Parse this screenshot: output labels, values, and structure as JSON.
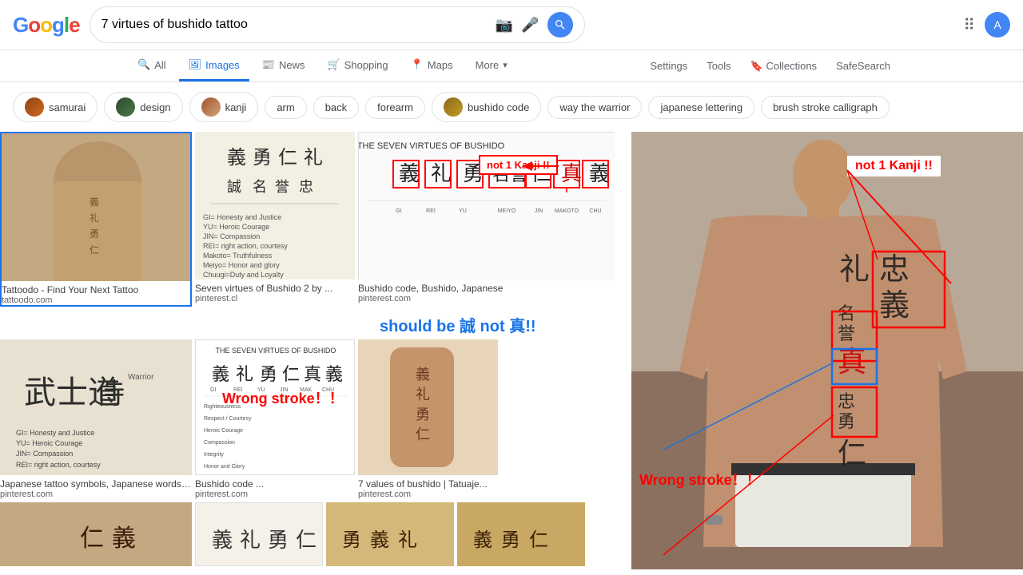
{
  "header": {
    "logo": [
      "G",
      "o",
      "o",
      "g",
      "l",
      "e"
    ],
    "search_query": "7 virtues of bushido tattoo",
    "search_placeholder": "Search"
  },
  "nav": {
    "tabs": [
      {
        "label": "All",
        "icon": "🔍",
        "active": false
      },
      {
        "label": "Images",
        "icon": "🖼",
        "active": true
      },
      {
        "label": "News",
        "icon": "📰",
        "active": false
      },
      {
        "label": "Shopping",
        "icon": "🛒",
        "active": false
      },
      {
        "label": "Maps",
        "icon": "📍",
        "active": false
      },
      {
        "label": "More",
        "icon": "",
        "active": false
      }
    ],
    "settings": "Settings",
    "tools": "Tools",
    "collections": "Collections",
    "safesearch": "SafeSearch"
  },
  "filters": [
    {
      "label": "samurai",
      "has_thumb": true
    },
    {
      "label": "design",
      "has_thumb": true
    },
    {
      "label": "kanji",
      "has_thumb": true
    },
    {
      "label": "arm",
      "has_thumb": false
    },
    {
      "label": "back",
      "has_thumb": false
    },
    {
      "label": "forearm",
      "has_thumb": false
    },
    {
      "label": "bushido code",
      "has_thumb": true
    },
    {
      "label": "way the warrior",
      "has_thumb": false
    },
    {
      "label": "japanese lettering",
      "has_thumb": false
    },
    {
      "label": "brush stroke calligraph",
      "has_thumb": false
    }
  ],
  "results": {
    "row1": [
      {
        "title": "Tattoodo - Find Your Next Tattoo",
        "source": "tattoodo.com",
        "featured": true
      },
      {
        "title": "Seven virtues of Bushido 2 by ...",
        "source": "pinterest.cl",
        "featured": false
      },
      {
        "title": "Bushido code, Bushido, Japanese",
        "source": "pinterest.com",
        "featured": false
      }
    ],
    "row2": [
      {
        "title": "Japanese tattoo symbols, Japanese words ...",
        "source": "pinterest.com",
        "featured": false
      },
      {
        "title": "Bushido code ...",
        "source": "pinterest.com",
        "featured": false
      },
      {
        "title": "7 values of bushido | Tatuaje...",
        "source": "pinterest.com",
        "featured": false
      }
    ],
    "row3": [
      {
        "title": "",
        "source": "",
        "featured": false
      },
      {
        "title": "",
        "source": "",
        "featured": false
      },
      {
        "title": "",
        "source": "",
        "featured": false
      },
      {
        "title": "",
        "source": "",
        "featured": false
      }
    ]
  },
  "annotations": {
    "not1kanji": "not 1 Kanji !!",
    "shouldbe": "should be 誠 not 真!!",
    "wrongstroke": "Wrong stroke！！",
    "arrow1": "→",
    "kanji_chars": [
      "義",
      "礼",
      "勇",
      "名誉",
      "仁",
      "真",
      "忠"
    ]
  },
  "feature_kanji": {
    "boxes": [
      "忠義",
      "礼",
      "名誉",
      "真",
      "忠",
      "勇",
      "仁"
    ]
  }
}
